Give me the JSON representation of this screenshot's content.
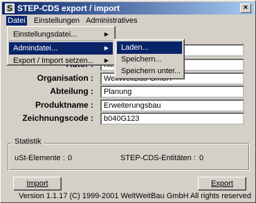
{
  "window": {
    "title": "STEP-CDS export / import",
    "icon_letter": "S",
    "close_glyph": "×"
  },
  "menubar": {
    "items": [
      {
        "label": "Datei"
      },
      {
        "label": "Einstellungen"
      },
      {
        "label": "Administratives"
      }
    ]
  },
  "datei_menu": {
    "items": [
      {
        "label": "Einstellungsdatei..."
      },
      {
        "label": "Admindatei..."
      },
      {
        "label": "Export / Import setzen..."
      }
    ]
  },
  "admin_submenu": {
    "items": [
      {
        "label": "Laden..."
      },
      {
        "label": "Speichern..."
      },
      {
        "label": "Speichern unter..."
      }
    ]
  },
  "form": {
    "fields": [
      {
        "label": "Autor :",
        "value": "hle"
      },
      {
        "label": "Organisation :",
        "value": "WeltWeitBau GmbH"
      },
      {
        "label": "Abteilung :",
        "value": "Planung"
      },
      {
        "label": "Produktname :",
        "value": "Erweiterungsbau"
      },
      {
        "label": "Zeichnungscode :",
        "value": "b040G123"
      }
    ]
  },
  "statistik": {
    "title": "Statistik",
    "ust_label": "uSt-Elemente :",
    "ust_value": "0",
    "cds_label": "STEP-CDS-Entitäten :",
    "cds_value": "0"
  },
  "buttons": {
    "import_label": "Import",
    "export_label": "Export"
  },
  "footer": {
    "text": "Version 1.1.17  (C) 1999-2001 WeltWeitBau GmbH  All rights reserved"
  },
  "colors": {
    "title_bar": "#0a246a",
    "face": "#d4d0c8",
    "highlight": "#0a246a"
  }
}
